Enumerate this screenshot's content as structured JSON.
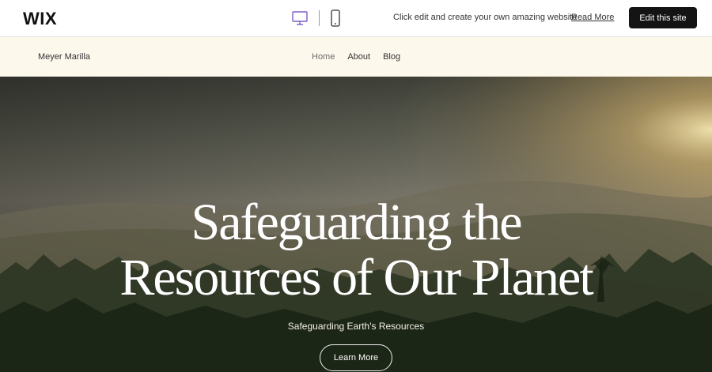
{
  "wix_bar": {
    "logo": "WIX",
    "desktop_icon": "desktop-monitor-icon",
    "mobile_icon": "mobile-phone-icon",
    "promo_text": "Click edit and create your own amazing website",
    "read_more": "Read More",
    "edit_button": "Edit this site",
    "accent_color": "#7b5cc4"
  },
  "site_header": {
    "site_name": "Meyer Marilla",
    "nav": [
      {
        "label": "Home",
        "active": true
      },
      {
        "label": "About",
        "active": false
      },
      {
        "label": "Blog",
        "active": false
      }
    ]
  },
  "hero": {
    "title_line1": "Safeguarding the",
    "title_line2": "Resources of Our Planet",
    "subtitle": "Safeguarding Earth's Resources",
    "button": "Learn More"
  }
}
